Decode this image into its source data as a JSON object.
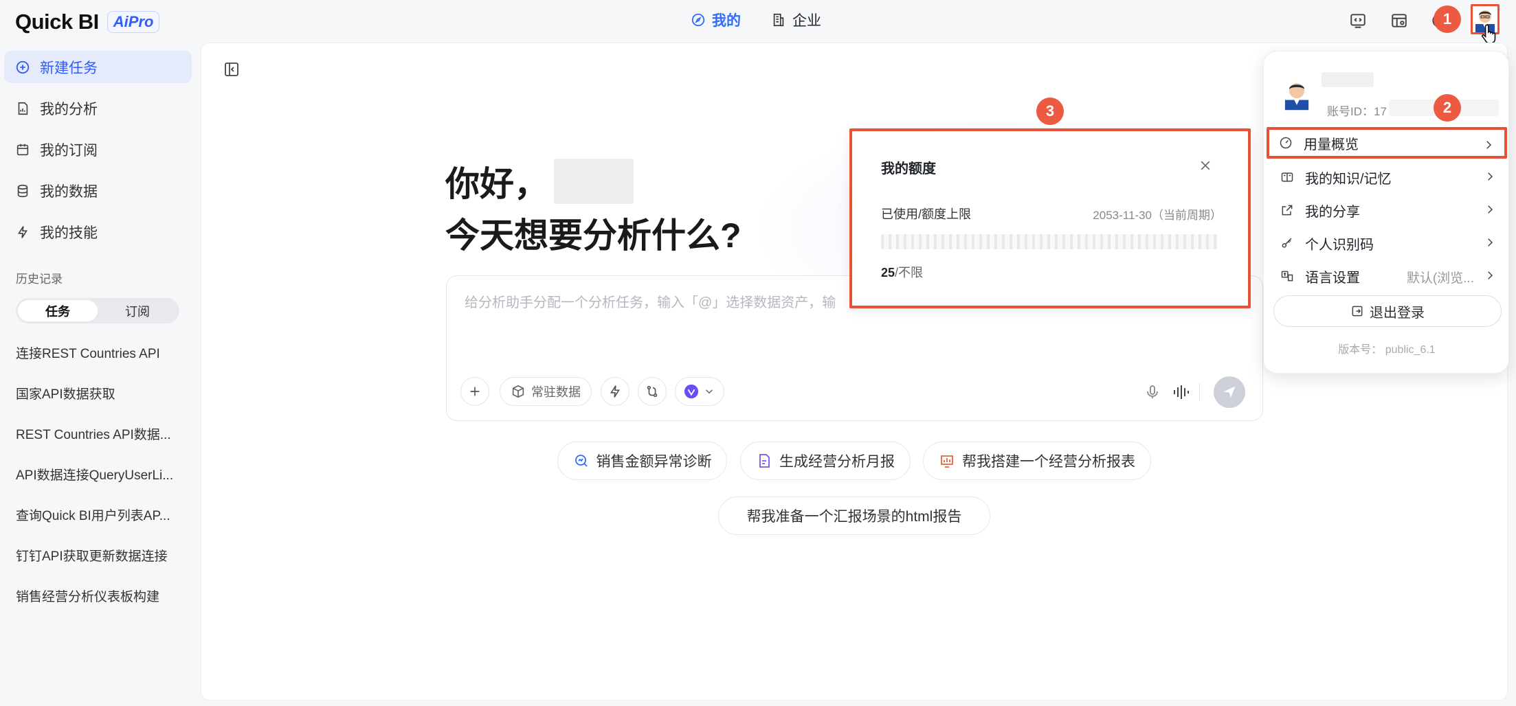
{
  "header": {
    "logo": "Quick BI",
    "badge": "AiPro",
    "nav": [
      {
        "label": "我的",
        "active": true
      },
      {
        "label": "企业",
        "active": false
      }
    ]
  },
  "sidebar": {
    "items": [
      {
        "label": "新建任务",
        "active": true
      },
      {
        "label": "我的分析"
      },
      {
        "label": "我的订阅"
      },
      {
        "label": "我的数据"
      },
      {
        "label": "我的技能"
      }
    ],
    "history_title": "历史记录",
    "tabs": [
      "任务",
      "订阅"
    ],
    "history": [
      "连接REST Countries API",
      "国家API数据获取",
      "REST Countries API数据...",
      "API数据连接QueryUserLi...",
      "查询Quick BI用户列表AP...",
      "钉钉API获取更新数据连接",
      "销售经营分析仪表板构建"
    ]
  },
  "main": {
    "greeting": "你好，",
    "question": "今天想要分析什么?",
    "input_placeholder": "给分析助手分配一个分析任务，输入「@」选择数据资产，输",
    "tool_resident": "常驻数据",
    "suggestions": [
      "销售金额异常诊断",
      "生成经营分析月报",
      "帮我搭建一个经营分析报表",
      "帮我准备一个汇报场景的html报告"
    ]
  },
  "quota": {
    "title": "我的额度",
    "label": "已使用/额度上限",
    "period": "2053-11-30（当前周期）",
    "used": "25",
    "limit": "/不限"
  },
  "account_menu": {
    "account_id_label": "账号ID：17",
    "items": [
      {
        "label": "用量概览"
      },
      {
        "label": "我的知识/记忆"
      },
      {
        "label": "我的分享"
      },
      {
        "label": "个人识别码"
      },
      {
        "label": "语言设置",
        "value": "默认(浏览..."
      }
    ],
    "logout": "退出登录",
    "version": "版本号： public_6.1"
  },
  "badges": [
    "1",
    "2",
    "3"
  ],
  "colors": {
    "accent": "#2f6bff",
    "highlight": "#e8503a"
  }
}
